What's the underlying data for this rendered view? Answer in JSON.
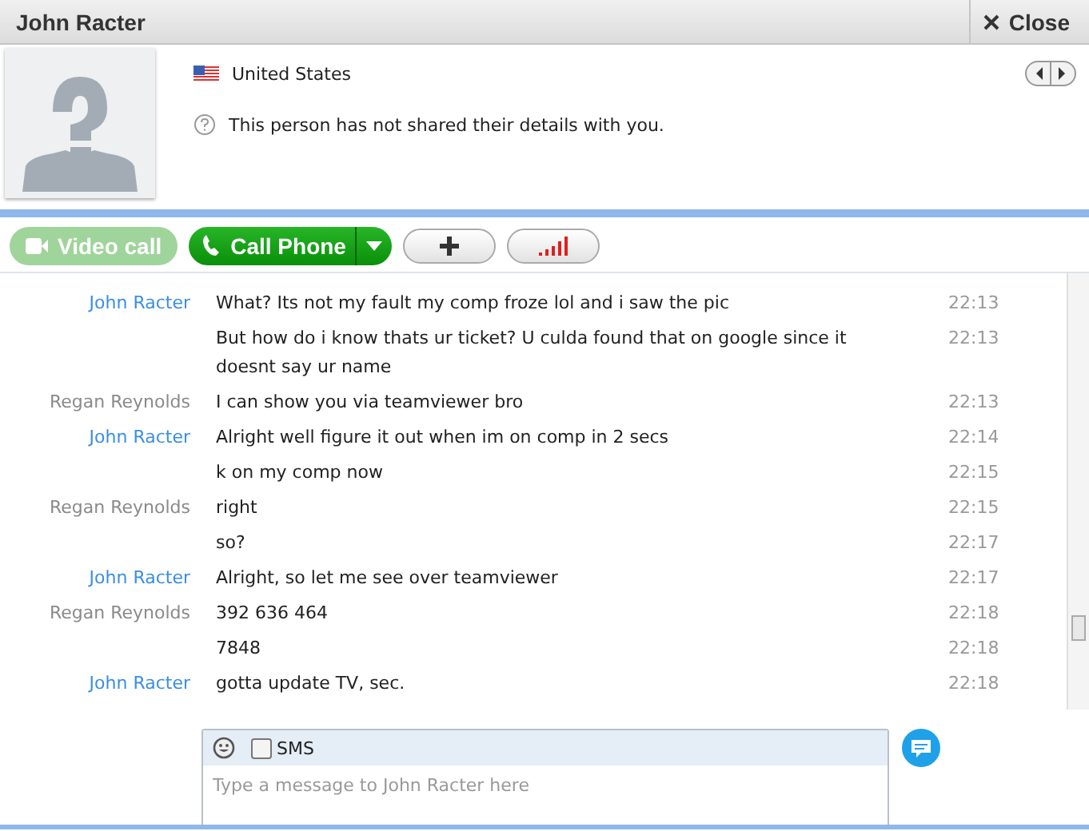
{
  "window": {
    "title": "John Racter",
    "close_label": "Close"
  },
  "profile": {
    "country": "United States",
    "notice": "This person has not shared their details with you."
  },
  "toolbar": {
    "video_call": {
      "label": "Video call",
      "disabled": true
    },
    "call_phone": {
      "label": "Call Phone"
    }
  },
  "messages": [
    {
      "sender": "John Racter",
      "kind": "contact",
      "text": "What? Its not my fault my comp froze lol and i saw the pic",
      "time": "22:13"
    },
    {
      "text": "But how do i know thats ur ticket? U culda found that on google since it doesnt say ur name",
      "time": "22:13"
    },
    {
      "sender": "Regan Reynolds",
      "kind": "me",
      "text": "I can show you via teamviewer bro",
      "time": "22:13"
    },
    {
      "sender": "John Racter",
      "kind": "contact",
      "text": "Alright well figure it out when im on comp in 2 secs",
      "time": "22:14"
    },
    {
      "text": "k on my comp now",
      "time": "22:15"
    },
    {
      "sender": "Regan Reynolds",
      "kind": "me",
      "text": "right",
      "time": "22:15"
    },
    {
      "text": "so?",
      "time": "22:17"
    },
    {
      "sender": "John Racter",
      "kind": "contact",
      "text": "Alright, so let me see over teamviewer",
      "time": "22:17"
    },
    {
      "sender": "Regan Reynolds",
      "kind": "me",
      "text": "392 636 464",
      "time": "22:18"
    },
    {
      "text": "7848",
      "time": "22:18"
    },
    {
      "sender": "John Racter",
      "kind": "contact",
      "text": "gotta update TV, sec.",
      "time": "22:18"
    }
  ],
  "composer": {
    "sms_label": "SMS",
    "sms_checked": false,
    "placeholder": "Type a message to John Racter here"
  }
}
